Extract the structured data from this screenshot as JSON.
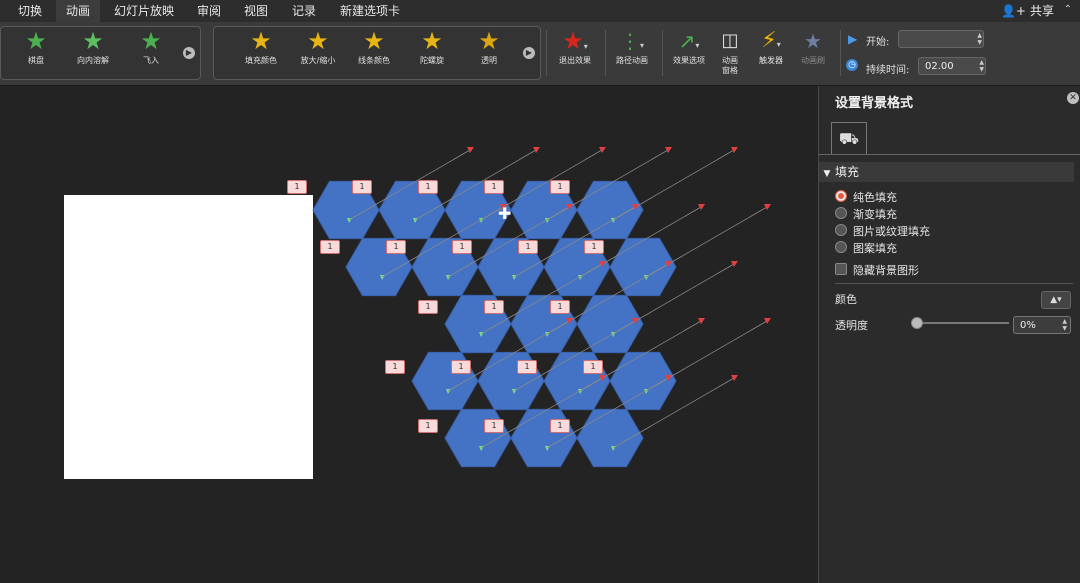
{
  "menu": {
    "tabs": [
      {
        "label": "切换",
        "active": false
      },
      {
        "label": "动画",
        "active": true
      },
      {
        "label": "幻灯片放映",
        "active": false
      },
      {
        "label": "审阅",
        "active": false
      },
      {
        "label": "视图",
        "active": false
      },
      {
        "label": "记录",
        "active": false
      },
      {
        "label": "新建选项卡",
        "active": false
      }
    ],
    "share_label": "共享"
  },
  "ribbon": {
    "entrance_gallery": [
      {
        "label": "棋盘",
        "icon": "star-green-icon"
      },
      {
        "label": "向内溶解",
        "icon": "star-green-icon"
      },
      {
        "label": "飞入",
        "icon": "star-green-icon"
      }
    ],
    "emphasis_gallery": [
      {
        "label": "填充颜色",
        "icon": "star-yellow-blue-icon"
      },
      {
        "label": "放大/缩小",
        "icon": "star-yellow-icon"
      },
      {
        "label": "线条颜色",
        "icon": "star-yellow-icon"
      },
      {
        "label": "陀螺旋",
        "icon": "star-yellow-spin-icon"
      },
      {
        "label": "透明",
        "icon": "star-yellow-icon"
      }
    ],
    "exit_effect": "退出效果",
    "path_animation": "路径动画",
    "effect_options": "效果选项",
    "animation_pane": "动画\n窗格",
    "trigger": "触发器",
    "animation_painter": "动画刷",
    "start_label": "开始:",
    "start_value": "",
    "duration_label": "持续时间:",
    "duration_value": "02.00"
  },
  "slide": {
    "background_color": "#ffffff",
    "hex_color": "#4472c4",
    "tag_text": "1"
  },
  "panel": {
    "title": "设置背景格式",
    "section": "填充",
    "fill_options": [
      {
        "label": "纯色填充",
        "selected": true
      },
      {
        "label": "渐变填充",
        "selected": false
      },
      {
        "label": "图片或纹理填充",
        "selected": false
      },
      {
        "label": "图案填充",
        "selected": false
      }
    ],
    "hide_bg_graphics": "隐藏背景图形",
    "color_label": "颜色",
    "transparency_label": "透明度",
    "transparency_value": "0%"
  },
  "colors": {
    "accent_orange": "#e25b3f",
    "hex_blue": "#4472c4",
    "motion_path_red": "#e04040"
  }
}
